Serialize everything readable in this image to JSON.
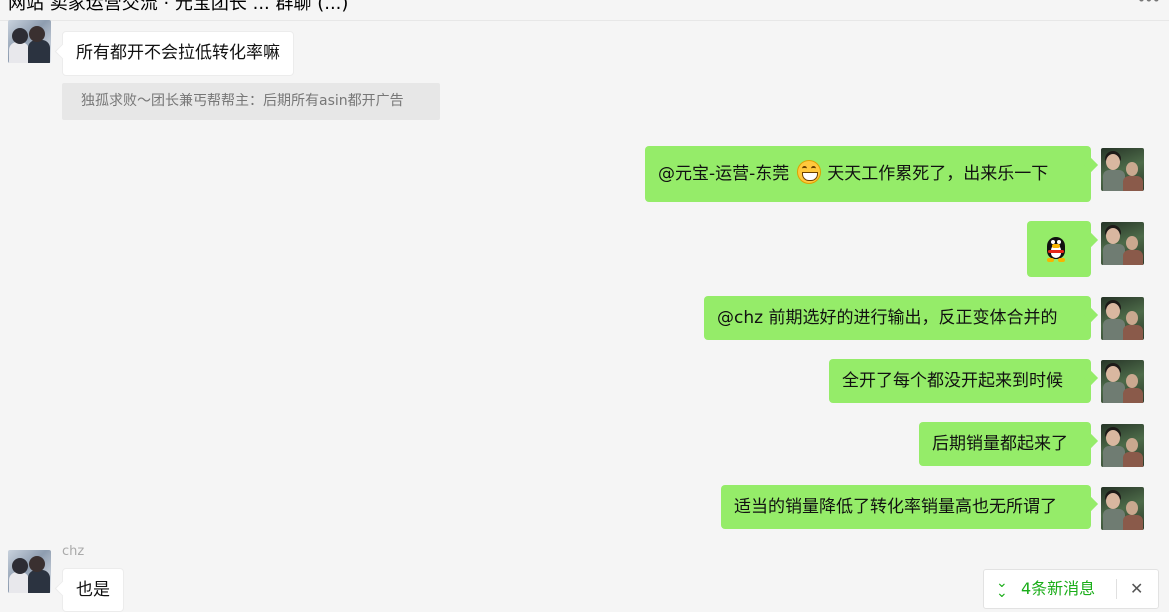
{
  "header": {
    "title": "网站 卖家运营交流 · 元宝团长 ... 群聊 (...)",
    "more_icon": "more-icon"
  },
  "messages": [
    {
      "side": "left",
      "sender": "",
      "text": "所有都开不会拉低转化率嘛",
      "quote": "独孤求败～团长兼丐帮帮主：后期所有asin都开广告"
    },
    {
      "side": "right",
      "mention": "@元宝-运营-东莞",
      "emoji": "grin-emoji",
      "text": "天天工作累死了，出来乐一下"
    },
    {
      "side": "right",
      "emoji_only": "qq-penguin-emoji"
    },
    {
      "side": "right",
      "text": "@chz 前期选好的进行输出，反正变体合并的"
    },
    {
      "side": "right",
      "text": "全开了每个都没开起来到时候"
    },
    {
      "side": "right",
      "text": "后期销量都起来了"
    },
    {
      "side": "right",
      "text": "适当的销量降低了转化率销量高也无所谓了"
    },
    {
      "side": "left",
      "sender": "chz",
      "text": "也是"
    }
  ],
  "new_messages": {
    "label": "4条新消息",
    "chevron_icon": "double-chevron-down-icon",
    "close_icon": "close-icon"
  },
  "colors": {
    "background": "#f5f5f5",
    "outgoing_bubble": "#95ec69",
    "incoming_bubble": "#ffffff",
    "accent_green": "#1aad19"
  }
}
